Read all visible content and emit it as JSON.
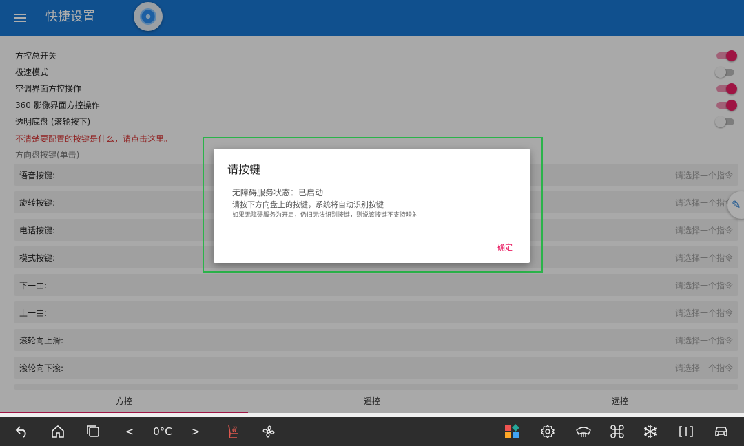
{
  "header": {
    "title": "快捷设置",
    "menu_icon": "menu-icon",
    "floating_icon": "floating-ball-icon"
  },
  "settings": [
    {
      "label": "方控总开关",
      "on": true
    },
    {
      "label": "极速模式",
      "on": false
    },
    {
      "label": "空调界面方控操作",
      "on": true
    },
    {
      "label": "360 影像界面方控操作",
      "on": true
    },
    {
      "label": "透明底盘 (滚轮按下)",
      "on": false
    }
  ],
  "hint_link": "不清楚要配置的按键是什么，请点击这里。",
  "section_label": "方向盘按键(单击)",
  "buttons": [
    {
      "label": "语音按键:",
      "value": "请选择一个指令"
    },
    {
      "label": "旋转按键:",
      "value": "请选择一个指令"
    },
    {
      "label": "电话按键:",
      "value": "请选择一个指令"
    },
    {
      "label": "模式按键:",
      "value": "请选择一个指令"
    },
    {
      "label": "下一曲:",
      "value": "请选择一个指令"
    },
    {
      "label": "上一曲:",
      "value": "请选择一个指令"
    },
    {
      "label": "滚轮向上滑:",
      "value": "请选择一个指令"
    },
    {
      "label": "滚轮向下滚:",
      "value": "请选择一个指令"
    }
  ],
  "tabs": [
    {
      "label": "方控",
      "active": true
    },
    {
      "label": "遥控"
    },
    {
      "label": "远控"
    }
  ],
  "dialog": {
    "title": "请按键",
    "status": "无障碍服务状态：已启动",
    "instruction": "请按下方向盘上的按键，系统将自动识别按键",
    "note": "如果无障碍服务为开启，仍旧无法识别按键，则说该按键不支持映射",
    "ok": "确定"
  },
  "navbar": {
    "temperature": "0°C",
    "temp_down": "<",
    "temp_up": ">",
    "icons": [
      "back-icon",
      "home-icon",
      "recents-icon",
      "seat-heat-icon",
      "fan-icon",
      "apps-icon",
      "settings-icon",
      "defrost-icon",
      "command-icon",
      "ac-snowflake-icon",
      "split-screen-icon",
      "car-icon"
    ]
  },
  "colors": {
    "primary": "#1976d2",
    "accent": "#e91e63",
    "link": "#d32f2f",
    "highlight": "#2bb34a",
    "navbar": "#2d2d2d"
  }
}
